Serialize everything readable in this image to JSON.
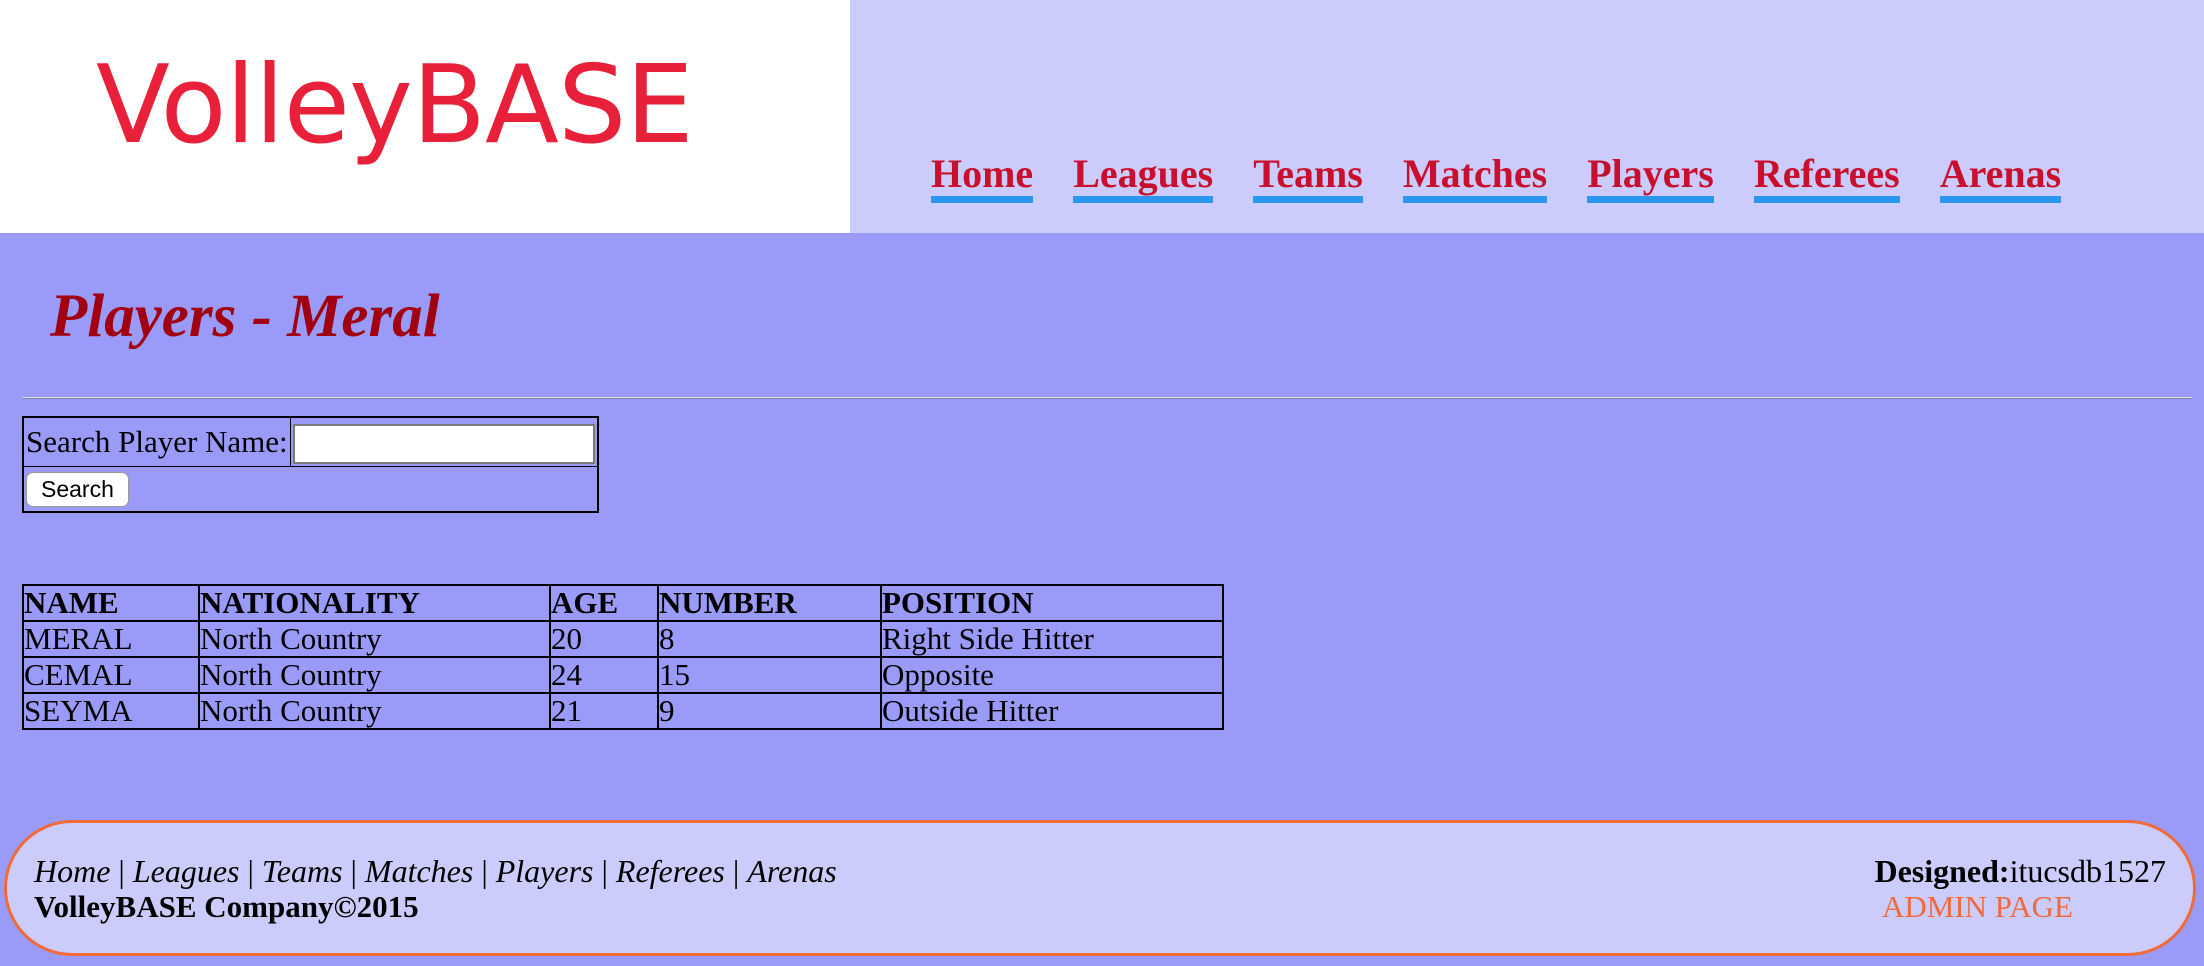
{
  "header": {
    "logo_text": "VolleyBASE",
    "nav": [
      "Home",
      "Leagues",
      "Teams",
      "Matches",
      "Players",
      "Referees",
      "Arenas"
    ]
  },
  "main": {
    "title": "Players - Meral",
    "search": {
      "label": "Search Player Name:",
      "value": "",
      "placeholder": "",
      "button_label": "Search"
    },
    "table": {
      "columns": [
        "NAME",
        "NATIONALITY",
        "AGE",
        "NUMBER",
        "POSITION"
      ],
      "rows": [
        [
          "MERAL",
          "North Country",
          "20",
          "8",
          "Right Side Hitter"
        ],
        [
          "CEMAL",
          "North Country",
          "24",
          "15",
          "Opposite"
        ],
        [
          "SEYMA",
          "North Country",
          "21",
          "9",
          "Outside Hitter"
        ]
      ]
    }
  },
  "footer": {
    "links": [
      "Home",
      "Leagues",
      "Teams",
      "Matches",
      "Players",
      "Referees",
      "Arenas"
    ],
    "separator": "|",
    "copyright": "VolleyBASE Company©2015",
    "designed_label": "Designed:",
    "designed_value": "itucsdb1527",
    "admin_link": "ADMIN PAGE"
  },
  "colors": {
    "page_bg": "#9a9af8",
    "header_bg": "#ccccfc",
    "logo_red": "#e8203a",
    "nav_text": "#c8102e",
    "nav_underline": "#2a96ee",
    "title_red": "#a00012",
    "footer_border": "#f06a3a"
  }
}
